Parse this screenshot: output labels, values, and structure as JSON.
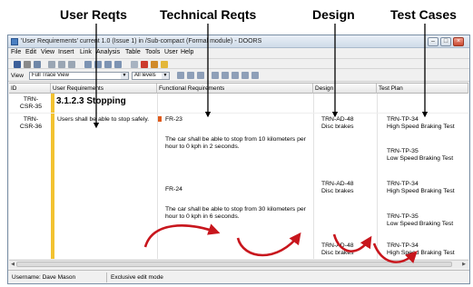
{
  "callouts": {
    "user": "User Reqts",
    "technical": "Technical Reqts",
    "design": "Design",
    "test": "Test Cases"
  },
  "window": {
    "title": "'User Requirements' current 1.0 (Issue 1) in /Sub-compact (Formal module) - DOORS",
    "controls": {
      "minimize": "–",
      "maximize": "□",
      "close": "×"
    }
  },
  "menu": [
    "File",
    "Edit",
    "View",
    "Insert",
    "Link",
    "Analysis",
    "Table",
    "Tools",
    "User",
    "Help"
  ],
  "viewbar": {
    "label": "View",
    "view_value": "Full Trace View",
    "levels_value": "All levels"
  },
  "columns": {
    "id": "ID",
    "user": "User Requirements",
    "functional": "Functional Requirements",
    "design": "Design",
    "test": "Test Plan"
  },
  "rows": {
    "section": {
      "id": "TRN-\nCSR-35",
      "heading": "3.1.2.3 Stopping"
    },
    "req": {
      "id": "TRN-\nCSR-36",
      "text": "Users shall be able to stop safely."
    }
  },
  "functional": [
    {
      "id": "FR-23",
      "text": "The car shall be able to stop from 10 kilometers per hour to 0 kph in 2 seconds."
    },
    {
      "id": "FR-24",
      "text": "The car shall be able to stop from 30 kilometers per hour to 0 kph in 6 seconds."
    }
  ],
  "design": [
    {
      "id": "TRN-AD-48",
      "name": "Disc brakes"
    },
    {
      "id": "TRN-AD-48",
      "name": "Disc brakes"
    },
    {
      "id": "TRN-AD-48",
      "name": "Disc brakes"
    }
  ],
  "tests": [
    {
      "id": "TRN-TP-34",
      "name": "High Speed Braking Test"
    },
    {
      "id": "TRN-TP-35",
      "name": "Low Speed Braking Test"
    },
    {
      "id": "TRN-TP-34",
      "name": "High Speed Braking Test"
    },
    {
      "id": "TRN-TP-35",
      "name": "Low Speed Braking Test"
    },
    {
      "id": "TRN-TP-34",
      "name": "High Speed Braking Test"
    }
  ],
  "status": {
    "user": "Username: Dave Mason",
    "mode": "Exclusive edit mode"
  },
  "colors": {
    "arrow": "#c8161d",
    "trace_bar": "#f2c230"
  }
}
